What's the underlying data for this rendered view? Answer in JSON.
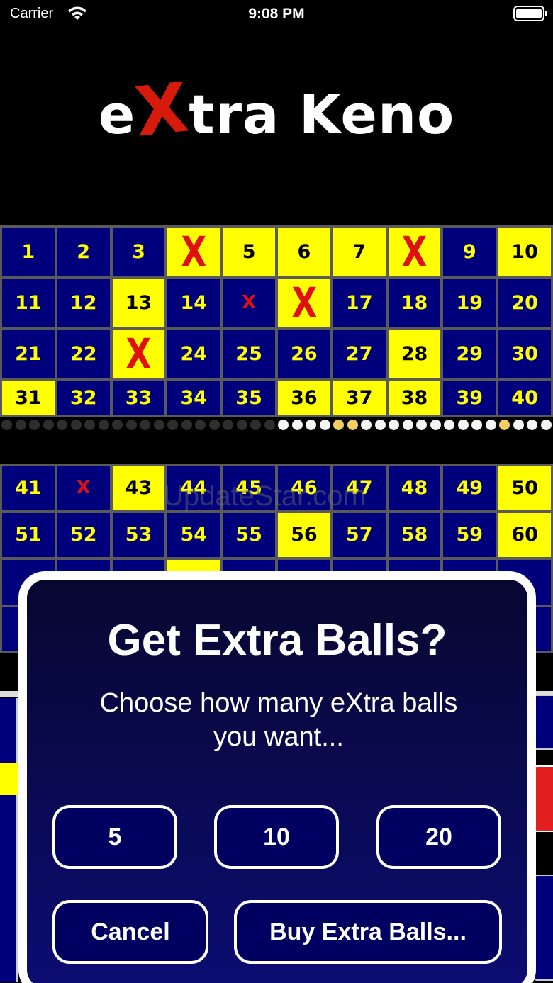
{
  "status_bar": {
    "carrier": "Carrier",
    "time": "9:08 PM"
  },
  "logo": {
    "part1": "e",
    "x": "X",
    "part2": "tra Keno"
  },
  "board_top": [
    {
      "label": "1",
      "state": "normal"
    },
    {
      "label": "2",
      "state": "normal"
    },
    {
      "label": "3",
      "state": "normal"
    },
    {
      "label": "X",
      "state": "x-big"
    },
    {
      "label": "5",
      "state": "hit"
    },
    {
      "label": "6",
      "state": "hit"
    },
    {
      "label": "7",
      "state": "hit"
    },
    {
      "label": "X",
      "state": "x-big"
    },
    {
      "label": "9",
      "state": "normal"
    },
    {
      "label": "10",
      "state": "hit"
    },
    {
      "label": "11",
      "state": "normal"
    },
    {
      "label": "12",
      "state": "normal"
    },
    {
      "label": "13",
      "state": "hit"
    },
    {
      "label": "14",
      "state": "normal"
    },
    {
      "label": "X",
      "state": "x-small"
    },
    {
      "label": "X",
      "state": "x-big"
    },
    {
      "label": "17",
      "state": "normal"
    },
    {
      "label": "18",
      "state": "normal"
    },
    {
      "label": "19",
      "state": "normal"
    },
    {
      "label": "20",
      "state": "normal"
    },
    {
      "label": "21",
      "state": "normal"
    },
    {
      "label": "22",
      "state": "normal"
    },
    {
      "label": "X",
      "state": "x-big"
    },
    {
      "label": "24",
      "state": "normal"
    },
    {
      "label": "25",
      "state": "normal"
    },
    {
      "label": "26",
      "state": "normal"
    },
    {
      "label": "27",
      "state": "normal"
    },
    {
      "label": "28",
      "state": "hit"
    },
    {
      "label": "29",
      "state": "normal"
    },
    {
      "label": "30",
      "state": "normal"
    },
    {
      "label": "31",
      "state": "hit"
    },
    {
      "label": "32",
      "state": "normal"
    },
    {
      "label": "33",
      "state": "normal"
    },
    {
      "label": "34",
      "state": "normal"
    },
    {
      "label": "35",
      "state": "normal"
    },
    {
      "label": "36",
      "state": "hit"
    },
    {
      "label": "37",
      "state": "hit"
    },
    {
      "label": "38",
      "state": "hit"
    },
    {
      "label": "39",
      "state": "normal"
    },
    {
      "label": "40",
      "state": "normal"
    }
  ],
  "board_bottom": [
    {
      "label": "41",
      "state": "normal"
    },
    {
      "label": "X",
      "state": "x-small"
    },
    {
      "label": "43",
      "state": "hit"
    },
    {
      "label": "44",
      "state": "normal"
    },
    {
      "label": "45",
      "state": "normal"
    },
    {
      "label": "46",
      "state": "normal"
    },
    {
      "label": "47",
      "state": "normal"
    },
    {
      "label": "48",
      "state": "normal"
    },
    {
      "label": "49",
      "state": "normal"
    },
    {
      "label": "50",
      "state": "hit"
    },
    {
      "label": "51",
      "state": "normal"
    },
    {
      "label": "52",
      "state": "normal"
    },
    {
      "label": "53",
      "state": "normal"
    },
    {
      "label": "54",
      "state": "normal"
    },
    {
      "label": "55",
      "state": "normal"
    },
    {
      "label": "56",
      "state": "hit"
    },
    {
      "label": "57",
      "state": "normal"
    },
    {
      "label": "58",
      "state": "normal"
    },
    {
      "label": "59",
      "state": "normal"
    },
    {
      "label": "60",
      "state": "hit"
    },
    {
      "label": "",
      "state": "normal"
    },
    {
      "label": "",
      "state": "normal"
    },
    {
      "label": "",
      "state": "normal"
    },
    {
      "label": "",
      "state": "hit"
    },
    {
      "label": "",
      "state": "normal"
    },
    {
      "label": "",
      "state": "normal"
    },
    {
      "label": "",
      "state": "normal"
    },
    {
      "label": "",
      "state": "normal"
    },
    {
      "label": "",
      "state": "normal"
    },
    {
      "label": "",
      "state": "normal"
    },
    {
      "label": "",
      "state": "normal"
    },
    {
      "label": "",
      "state": "normal"
    },
    {
      "label": "",
      "state": "normal"
    },
    {
      "label": "",
      "state": "normal"
    },
    {
      "label": "",
      "state": "normal"
    },
    {
      "label": "",
      "state": "normal"
    },
    {
      "label": "",
      "state": "normal"
    },
    {
      "label": "",
      "state": "normal"
    },
    {
      "label": "",
      "state": "normal"
    },
    {
      "label": "",
      "state": "normal"
    }
  ],
  "ball_tracker": [
    "off",
    "off",
    "off",
    "off",
    "off",
    "off",
    "off",
    "off",
    "off",
    "off",
    "off",
    "off",
    "off",
    "off",
    "off",
    "off",
    "off",
    "off",
    "off",
    "off",
    "white",
    "white",
    "white",
    "white",
    "gold",
    "gold",
    "white",
    "white",
    "white",
    "white",
    "white",
    "white",
    "white",
    "white",
    "white",
    "white",
    "gold",
    "white",
    "white",
    "white"
  ],
  "watermark": "UpdateStar.com",
  "dialog": {
    "title": "Get Extra Balls?",
    "message": "Choose how many eXtra balls you want...",
    "options": [
      "5",
      "10",
      "20"
    ],
    "cancel_label": "Cancel",
    "buy_label": "Buy Extra Balls..."
  },
  "colors": {
    "cell_blue": "#00007c",
    "hit_yellow": "#ffff00",
    "mark_red": "#e01010"
  }
}
